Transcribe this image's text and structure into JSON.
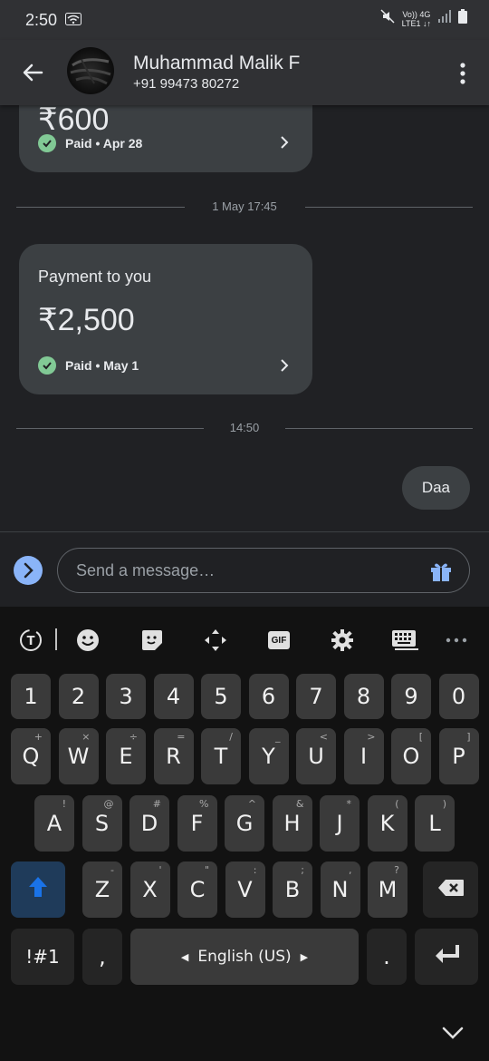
{
  "status_bar": {
    "time": "2:50",
    "network_top": "Vo)) 4G",
    "network_bottom": "LTE1 ↓↑"
  },
  "header": {
    "name": "Muhammad Malik F",
    "phone": "+91 99473 80272"
  },
  "chat": {
    "top_card": {
      "amount": "₹600",
      "status": "Paid • Apr 28"
    },
    "divider1": "1 May 17:45",
    "payment_card": {
      "title": "Payment to you",
      "amount": "₹2,500",
      "status": "Paid • May 1"
    },
    "divider2": "14:50",
    "outgoing_message": "Daa"
  },
  "compose": {
    "placeholder": "Send a message…"
  },
  "keyboard": {
    "row_numbers": [
      "1",
      "2",
      "3",
      "4",
      "5",
      "6",
      "7",
      "8",
      "9",
      "0"
    ],
    "row_q": [
      {
        "k": "Q",
        "s": "+"
      },
      {
        "k": "W",
        "s": "×"
      },
      {
        "k": "E",
        "s": "÷"
      },
      {
        "k": "R",
        "s": "="
      },
      {
        "k": "T",
        "s": "/"
      },
      {
        "k": "Y",
        "s": "_"
      },
      {
        "k": "U",
        "s": "<"
      },
      {
        "k": "I",
        "s": ">"
      },
      {
        "k": "O",
        "s": "["
      },
      {
        "k": "P",
        "s": "]"
      }
    ],
    "row_a": [
      {
        "k": "A",
        "s": "!"
      },
      {
        "k": "S",
        "s": "@"
      },
      {
        "k": "D",
        "s": "#"
      },
      {
        "k": "F",
        "s": "%"
      },
      {
        "k": "G",
        "s": "^"
      },
      {
        "k": "H",
        "s": "&"
      },
      {
        "k": "J",
        "s": "*"
      },
      {
        "k": "K",
        "s": "("
      },
      {
        "k": "L",
        "s": ")"
      }
    ],
    "row_z": [
      {
        "k": "Z",
        "s": "-"
      },
      {
        "k": "X",
        "s": "'"
      },
      {
        "k": "C",
        "s": "\""
      },
      {
        "k": "V",
        "s": ":"
      },
      {
        "k": "B",
        "s": ";"
      },
      {
        "k": "N",
        "s": ","
      },
      {
        "k": "M",
        "s": "?"
      }
    ],
    "symbols_key": "!#1",
    "comma_key": ",",
    "space_label": "English (US)",
    "period_key": "."
  },
  "colors": {
    "accent": "#8ab4f8",
    "paid_check": "#81c995",
    "shift": "#1a73e8"
  }
}
